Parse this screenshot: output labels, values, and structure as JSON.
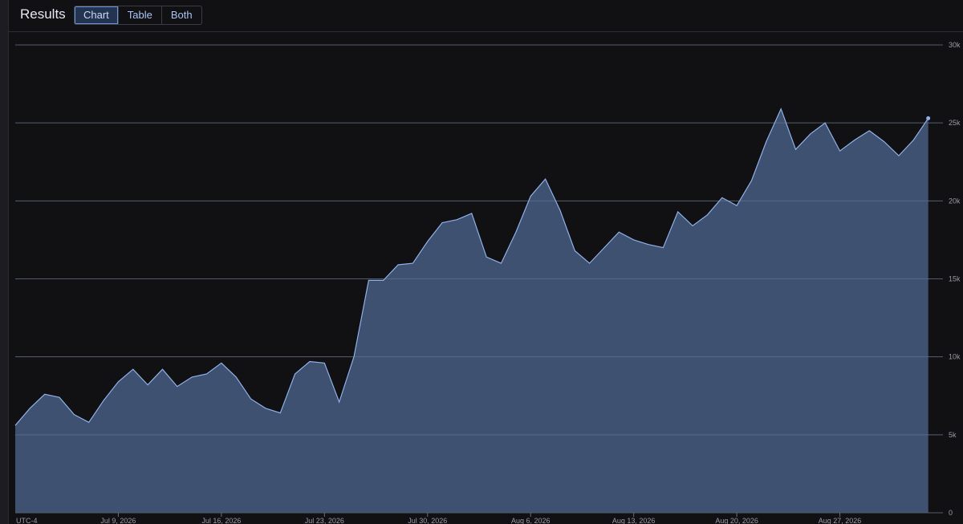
{
  "header": {
    "title": "Results",
    "tabs": [
      {
        "label": "Chart",
        "active": true
      },
      {
        "label": "Table",
        "active": false
      },
      {
        "label": "Both",
        "active": false
      }
    ]
  },
  "colors": {
    "area_fill": "#3f5170",
    "line": "#8fb0e8",
    "grid": "#3a3d45",
    "tick_text": "#9a9aa2",
    "accent": "#a9c4f5"
  },
  "chart_data": {
    "type": "area",
    "timezone_label": "UTC-4",
    "x_tick_labels": [
      "Jul 9, 2026",
      "Jul 16, 2026",
      "Jul 23, 2026",
      "Jul 30, 2026",
      "Aug 6, 2026",
      "Aug 13, 2026",
      "Aug 20, 2026",
      "Aug 27, 2026"
    ],
    "y_tick_labels": [
      "0",
      "5k",
      "10k",
      "15k",
      "20k",
      "25k",
      "30k"
    ],
    "ylim": [
      0,
      30000
    ],
    "xlim": [
      "2026-07-02",
      "2026-09-03"
    ],
    "grid": true,
    "series": [
      {
        "points": [
          [
            "2026-07-02",
            5600
          ],
          [
            "2026-07-03",
            6700
          ],
          [
            "2026-07-04",
            7600
          ],
          [
            "2026-07-05",
            7400
          ],
          [
            "2026-07-06",
            6300
          ],
          [
            "2026-07-07",
            5800
          ],
          [
            "2026-07-08",
            7200
          ],
          [
            "2026-07-09",
            8400
          ],
          [
            "2026-07-10",
            9200
          ],
          [
            "2026-07-11",
            8200
          ],
          [
            "2026-07-12",
            9200
          ],
          [
            "2026-07-13",
            8100
          ],
          [
            "2026-07-14",
            8700
          ],
          [
            "2026-07-15",
            8900
          ],
          [
            "2026-07-16",
            9600
          ],
          [
            "2026-07-17",
            8700
          ],
          [
            "2026-07-18",
            7300
          ],
          [
            "2026-07-19",
            6700
          ],
          [
            "2026-07-20",
            6400
          ],
          [
            "2026-07-21",
            8900
          ],
          [
            "2026-07-22",
            9700
          ],
          [
            "2026-07-23",
            9600
          ],
          [
            "2026-07-24",
            7100
          ],
          [
            "2026-07-25",
            10000
          ],
          [
            "2026-07-26",
            14900
          ],
          [
            "2026-07-27",
            14900
          ],
          [
            "2026-07-28",
            15900
          ],
          [
            "2026-07-29",
            16000
          ],
          [
            "2026-07-30",
            17400
          ],
          [
            "2026-07-31",
            18600
          ],
          [
            "2026-08-01",
            18800
          ],
          [
            "2026-08-02",
            19200
          ],
          [
            "2026-08-03",
            16400
          ],
          [
            "2026-08-04",
            16000
          ],
          [
            "2026-08-05",
            18000
          ],
          [
            "2026-08-06",
            20300
          ],
          [
            "2026-08-07",
            21400
          ],
          [
            "2026-08-08",
            19400
          ],
          [
            "2026-08-09",
            16800
          ],
          [
            "2026-08-10",
            16000
          ],
          [
            "2026-08-11",
            17000
          ],
          [
            "2026-08-12",
            18000
          ],
          [
            "2026-08-13",
            17500
          ],
          [
            "2026-08-14",
            17200
          ],
          [
            "2026-08-15",
            17000
          ],
          [
            "2026-08-16",
            19300
          ],
          [
            "2026-08-17",
            18400
          ],
          [
            "2026-08-18",
            19100
          ],
          [
            "2026-08-19",
            20200
          ],
          [
            "2026-08-20",
            19700
          ],
          [
            "2026-08-21",
            21300
          ],
          [
            "2026-08-22",
            23800
          ],
          [
            "2026-08-23",
            25900
          ],
          [
            "2026-08-24",
            23300
          ],
          [
            "2026-08-25",
            24300
          ],
          [
            "2026-08-26",
            25000
          ],
          [
            "2026-08-27",
            23200
          ],
          [
            "2026-08-28",
            23900
          ],
          [
            "2026-08-29",
            24500
          ],
          [
            "2026-08-30",
            23800
          ],
          [
            "2026-08-31",
            22900
          ],
          [
            "2026-09-01",
            23900
          ],
          [
            "2026-09-02",
            25300
          ]
        ]
      }
    ]
  }
}
